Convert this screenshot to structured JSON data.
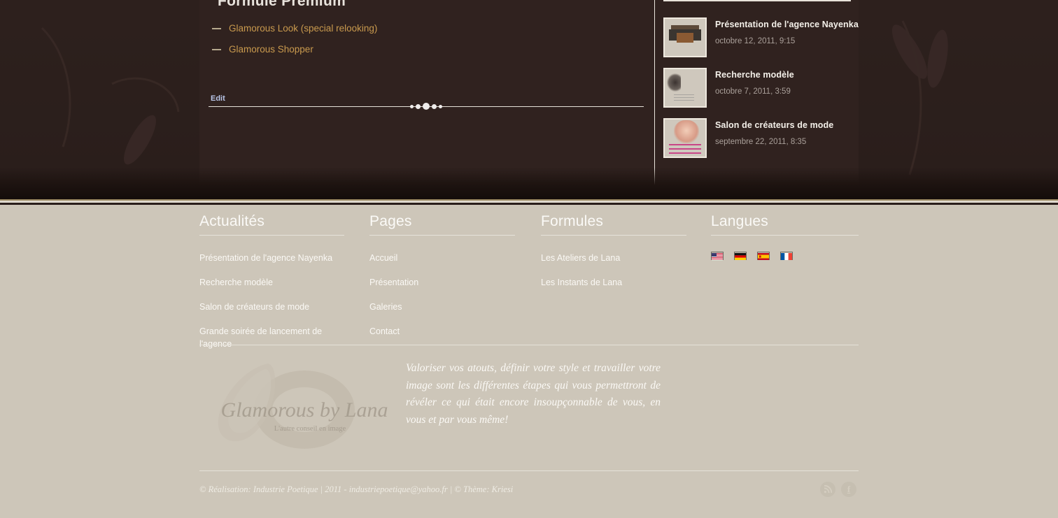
{
  "slider": {
    "title": "Formule Premium",
    "items": [
      {
        "label": "Glamorous Look (special relooking)"
      },
      {
        "label": "Glamorous Shopper"
      }
    ],
    "edit_label": "Edit",
    "dots": [
      "",
      "",
      "",
      "",
      ""
    ],
    "active_dot_index": 2
  },
  "sidebar": {
    "posts": [
      {
        "title": "Présentation de l'agence Nayenka",
        "date": "octobre 12, 2011, 9:15",
        "thumb": "storefront-thumbnail"
      },
      {
        "title": "Recherche modèle",
        "date": "octobre 7, 2011, 3:59",
        "thumb": "model-thumbnail"
      },
      {
        "title": "Salon de créateurs de mode",
        "date": "septembre 22, 2011, 8:35",
        "thumb": "poster-thumbnail"
      }
    ]
  },
  "footer": {
    "columns": [
      {
        "heading": "Actualités",
        "links": [
          "Présentation de l'agence Nayenka",
          "Recherche modèle",
          "Salon de créateurs de mode",
          "Grande soirée de lancement de l'agence"
        ]
      },
      {
        "heading": "Pages",
        "links": [
          "Accueil",
          "Présentation",
          "Galeries",
          "Contact"
        ]
      },
      {
        "heading": "Formules",
        "links": [
          "Les Ateliers de Lana",
          "Les Instants de Lana"
        ]
      },
      {
        "heading": "Langues",
        "links": []
      }
    ],
    "flags": [
      {
        "name": "flag-united-states"
      },
      {
        "name": "flag-germany"
      },
      {
        "name": "flag-spain"
      },
      {
        "name": "flag-france"
      }
    ],
    "logo": {
      "wordmark": "Glamorous by Lana",
      "subtitle": "L'autre conseil en image"
    },
    "tagline": "Valoriser vos atouts, définir votre style et travailler votre image sont les différentes étapes qui vous permettront de révéler ce qui était encore insoupçonnable de vous, en vous et par vous même!",
    "copyright": "© Réalisation: Industrie Poetique | 2011 - industriepoetique@yahoo.fr | © Thème: Kriesi",
    "social": [
      {
        "name": "rss-icon",
        "glyph": ""
      },
      {
        "name": "facebook-icon",
        "glyph": "f"
      }
    ]
  },
  "colors": {
    "dark_bg": "#2b1f1c",
    "accent_gold": "#c99a4e",
    "footer_bg": "#cdc6b9",
    "rule_gold": "#9d8b64",
    "link_light": "#fbf9f5",
    "edit_link": "#b9c6e8"
  }
}
